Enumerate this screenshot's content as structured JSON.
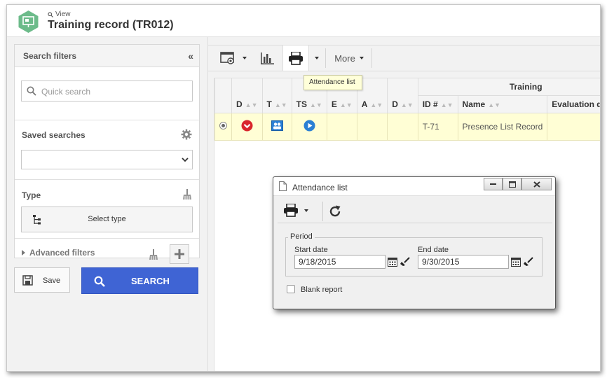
{
  "header": {
    "breadcrumb": "View",
    "title": "Training record (TR012)"
  },
  "filters": {
    "title": "Search filters",
    "quick_search_placeholder": "Quick search",
    "saved_searches_label": "Saved searches",
    "saved_searches_value": "",
    "type_label": "Type",
    "select_type_label": "Select type",
    "advanced_filters_label": "Advanced filters",
    "save_label": "Save",
    "search_label": "SEARCH"
  },
  "toolbar": {
    "more_label": "More",
    "tooltip": "Attendance list"
  },
  "grid": {
    "group_header": "Training",
    "columns": [
      "D",
      "T",
      "TS",
      "E",
      "A",
      "D",
      "ID #",
      "Name",
      "Evaluation date"
    ],
    "rows": [
      {
        "id": "T-71",
        "name": "Presence List Record",
        "evaluation_date": ""
      }
    ]
  },
  "dialog": {
    "title": "Attendance list",
    "period_label": "Period",
    "start_label": "Start date",
    "start_value": "9/18/2015",
    "end_label": "End date",
    "end_value": "9/30/2015",
    "blank_report_label": "Blank report"
  },
  "colors": {
    "accent": "#3f64d4",
    "logo_green": "#6cbb8a",
    "row_highlight": "#fffed5",
    "status_red": "#d9262c",
    "status_blue": "#2a7fd4"
  }
}
